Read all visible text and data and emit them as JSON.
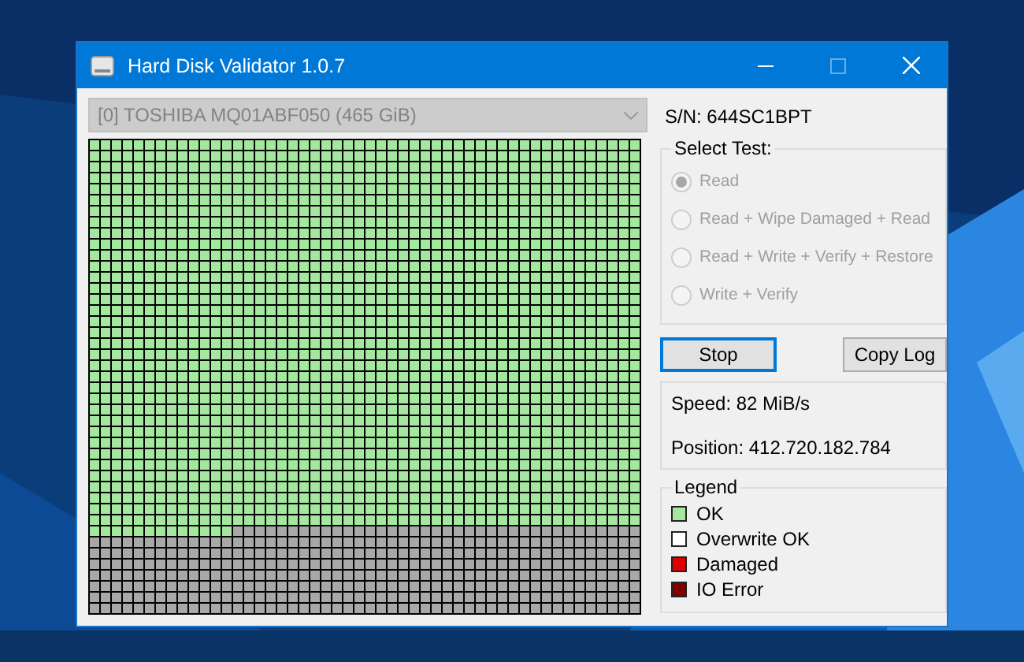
{
  "window": {
    "title": "Hard Disk Validator 1.0.7"
  },
  "drive_select": {
    "value": "[0] TOSHIBA MQ01ABF050 (465 GiB)",
    "disabled": true
  },
  "serial": "S/N: 644SC1BPT",
  "test_group": {
    "title": "Select Test:",
    "options": [
      {
        "label": "Read",
        "selected": true,
        "disabled": true
      },
      {
        "label": "Read + Wipe Damaged + Read",
        "selected": false,
        "disabled": true
      },
      {
        "label": "Read + Write + Verify + Restore",
        "selected": false,
        "disabled": true
      },
      {
        "label": "Write + Verify",
        "selected": false,
        "disabled": true
      }
    ]
  },
  "buttons": [
    {
      "label": "Stop",
      "focused": true
    },
    {
      "label": "Copy Log",
      "focused": false
    }
  ],
  "stats": [
    "Speed: 82 MiB/s",
    "Position: 412.720.182.784"
  ],
  "legend": {
    "title": "Legend",
    "items": [
      {
        "label": "OK",
        "color": "#a4e8a0"
      },
      {
        "label": "Overwrite OK",
        "color": "#ffffff"
      },
      {
        "label": "Damaged",
        "color": "#e00000"
      },
      {
        "label": "IO Error",
        "color": "#800000"
      }
    ]
  }
}
